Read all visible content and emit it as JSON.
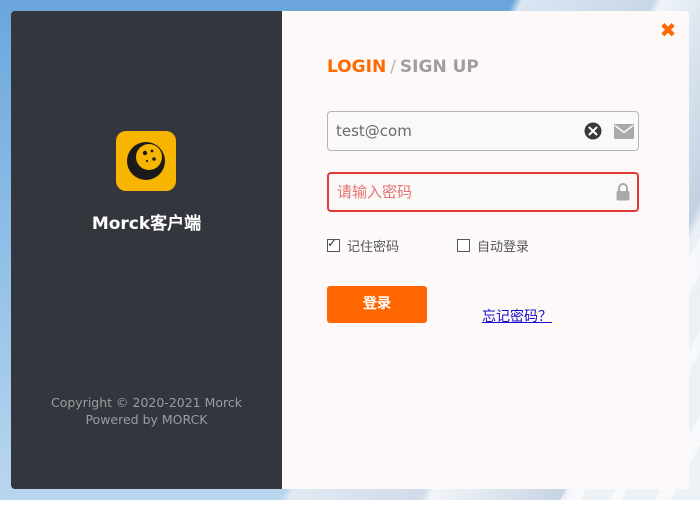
{
  "app": {
    "name": "Morck客户端",
    "copyright_line1": "Copyright © 2020-2021 Morck",
    "copyright_line2": "Powered by MORCK"
  },
  "tabs": {
    "login": "LOGIN",
    "separator": "/",
    "signup": "SIGN UP"
  },
  "email_field": {
    "value": "test@com",
    "placeholder": "",
    "clear_icon": "clear-circle-icon",
    "trailing_icon": "envelope-icon"
  },
  "password_field": {
    "value": "",
    "placeholder": "请输入密码",
    "trailing_icon": "lock-icon"
  },
  "options": {
    "remember_label": "记住密码",
    "remember_checked": true,
    "auto_login_label": "自动登录",
    "auto_login_checked": false
  },
  "actions": {
    "login_label": "登录",
    "forgot_label": "忘记密码？"
  },
  "colors": {
    "accent": "#ff6600",
    "left_panel": "#33363d",
    "logo": "#f7b500",
    "error_border": "#e53935",
    "link": "#1a0dcc"
  }
}
